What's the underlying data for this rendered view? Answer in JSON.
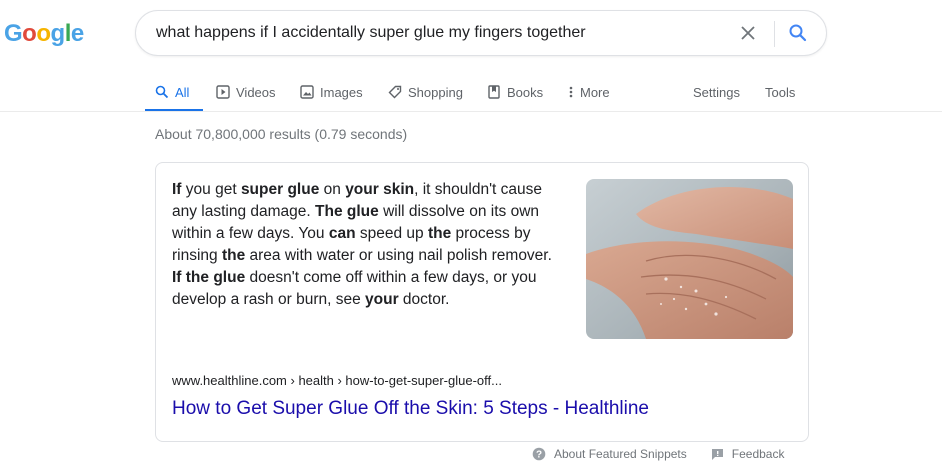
{
  "logo": {
    "letters": [
      "G",
      "o",
      "o",
      "g",
      "l",
      "e"
    ]
  },
  "search": {
    "query": "what happens if I accidentally super glue my fingers together"
  },
  "tabs": [
    {
      "label": "All",
      "icon": "search-icon",
      "active": true
    },
    {
      "label": "Videos",
      "icon": "video-icon",
      "active": false
    },
    {
      "label": "Images",
      "icon": "image-icon",
      "active": false
    },
    {
      "label": "Shopping",
      "icon": "tag-icon",
      "active": false
    },
    {
      "label": "Books",
      "icon": "book-icon",
      "active": false
    },
    {
      "label": "More",
      "icon": "more-vert-icon",
      "active": false
    }
  ],
  "tools": {
    "settings": "Settings",
    "tools": "Tools"
  },
  "stats": "About 70,800,000 results (0.79 seconds)",
  "snippet": {
    "segments": [
      {
        "text": "If",
        "bold": true
      },
      {
        "text": " you get ",
        "bold": false
      },
      {
        "text": "super glue",
        "bold": true
      },
      {
        "text": " on ",
        "bold": false
      },
      {
        "text": "your skin",
        "bold": true
      },
      {
        "text": ", it shouldn't cause any lasting damage. ",
        "bold": false
      },
      {
        "text": "The glue",
        "bold": true
      },
      {
        "text": " will dissolve on its own within a few days. You ",
        "bold": false
      },
      {
        "text": "can",
        "bold": true
      },
      {
        "text": " speed up ",
        "bold": false
      },
      {
        "text": "the",
        "bold": true
      },
      {
        "text": " process by rinsing ",
        "bold": false
      },
      {
        "text": "the",
        "bold": true
      },
      {
        "text": " area with water or using nail polish remover. ",
        "bold": false
      },
      {
        "text": "If the glue",
        "bold": true
      },
      {
        "text": " doesn't come off within a few days, or you develop a rash or burn, see ",
        "bold": false
      },
      {
        "text": "your",
        "bold": true
      },
      {
        "text": " doctor.",
        "bold": false
      }
    ],
    "source": "www.healthline.com › health › how-to-get-super-glue-off...",
    "title": "How to Get Super Glue Off the Skin: 5 Steps - Healthline"
  },
  "footer": {
    "about": "About Featured Snippets",
    "feedback": "Feedback"
  },
  "colors": {
    "link": "#1a0dab",
    "accent": "#1a73e8",
    "muted": "#70757a"
  }
}
